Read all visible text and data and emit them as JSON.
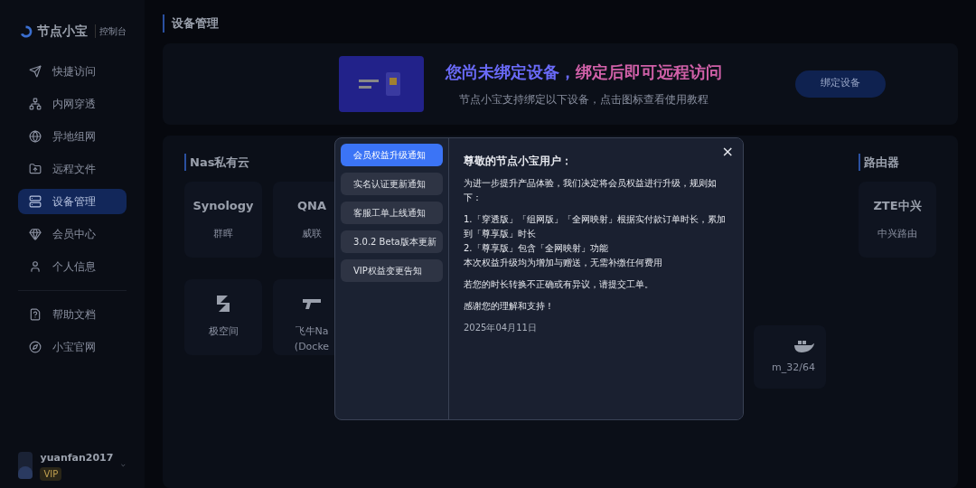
{
  "sidebar": {
    "logo": "节点小宝",
    "logo_sub": "控制台",
    "items": [
      {
        "label": "快捷访问",
        "selected": false
      },
      {
        "label": "内网穿透",
        "selected": false
      },
      {
        "label": "异地组网",
        "selected": false
      },
      {
        "label": "远程文件",
        "selected": false
      },
      {
        "label": "设备管理",
        "selected": true
      },
      {
        "label": "会员中心",
        "selected": false
      },
      {
        "label": "个人信息",
        "selected": false
      }
    ],
    "footer_items": [
      {
        "label": "帮助文档",
        "selected": false
      },
      {
        "label": "小宝官网",
        "selected": false
      }
    ],
    "user": {
      "name": "yuanfan2017",
      "badge": "VIP"
    }
  },
  "page_title": "设备管理",
  "banner": {
    "title_part1": "您尚未绑定设备，",
    "title_part2": "绑定后即可远程访问",
    "subtitle": "节点小宝支持绑定以下设备，点击图标查看使用教程",
    "button": "绑定设备"
  },
  "nas": {
    "title": "Nas私有云",
    "cards": [
      {
        "kind": "text",
        "logo": "Synology",
        "label": "群晖"
      },
      {
        "kind": "text",
        "logo": "QNA",
        "label": "威联"
      },
      {
        "kind": "icon",
        "label": "极空间"
      },
      {
        "kind": "docker",
        "label": "飞牛Na",
        "sub": "(Docke"
      }
    ]
  },
  "docker_card": {
    "label": "m_32/64"
  },
  "router": {
    "title": "路由器",
    "cards": [
      {
        "kind": "text",
        "logo": "ZTE中兴",
        "label": "中兴路由"
      }
    ]
  },
  "modal": {
    "tabs": [
      {
        "label": "会员权益升级通知",
        "selected": true
      },
      {
        "label": "实名认证更新通知",
        "selected": false
      },
      {
        "label": "客服工单上线通知",
        "selected": false
      },
      {
        "label": "3.0.2 Beta版本更新",
        "selected": false
      },
      {
        "label": "VIP权益变更告知",
        "selected": false
      }
    ],
    "heading": "尊敬的节点小宝用户：",
    "paragraphs": [
      [
        "为进一步提升产品体验，我们决定将会员权益进行升级，规则如下："
      ],
      [
        "1.「穿透版」「组网版」「全网映射」根据实付款订单时长，累加到「尊享版」时长",
        "2.「尊享版」包含「全网映射」功能",
        "本次权益升级均为增加与赠送，无需补缴任何费用"
      ],
      [
        "若您的时长转换不正确或有异议，请提交工单。"
      ],
      [
        "感谢您的理解和支持！"
      ]
    ],
    "date": "2025年04月11日",
    "close": "×"
  }
}
